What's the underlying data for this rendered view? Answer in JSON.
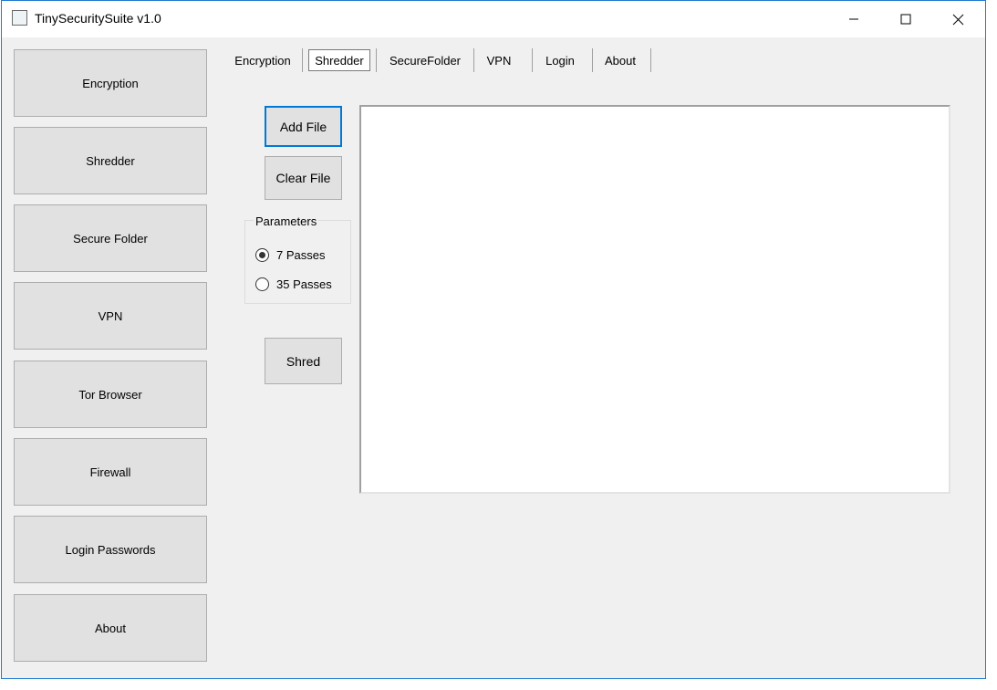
{
  "window": {
    "title": "TinySecuritySuite v1.0",
    "accent": "#0078d7"
  },
  "titlebar_buttons": {
    "minimize_icon": "minimize-icon",
    "maximize_icon": "maximize-icon",
    "close_icon": "close-icon"
  },
  "sidebar": {
    "items": [
      {
        "label": "Encryption"
      },
      {
        "label": "Shredder"
      },
      {
        "label": "Secure Folder"
      },
      {
        "label": "VPN"
      },
      {
        "label": "Tor Browser"
      },
      {
        "label": "Firewall"
      },
      {
        "label": "Login Passwords"
      },
      {
        "label": "About"
      }
    ]
  },
  "tabs": [
    {
      "label": "Encryption",
      "selected": false
    },
    {
      "label": "Shredder",
      "selected": true
    },
    {
      "label": "SecureFolder",
      "selected": false
    },
    {
      "label": "VPN",
      "selected": false
    },
    {
      "label": "Login",
      "selected": false
    },
    {
      "label": "About",
      "selected": false
    }
  ],
  "shredder": {
    "add_file_label": "Add File",
    "clear_file_label": "Clear File",
    "parameters_title": "Parameters",
    "options": [
      {
        "label": "7 Passes",
        "checked": true
      },
      {
        "label": "35 Passes",
        "checked": false
      }
    ],
    "shred_label": "Shred"
  }
}
